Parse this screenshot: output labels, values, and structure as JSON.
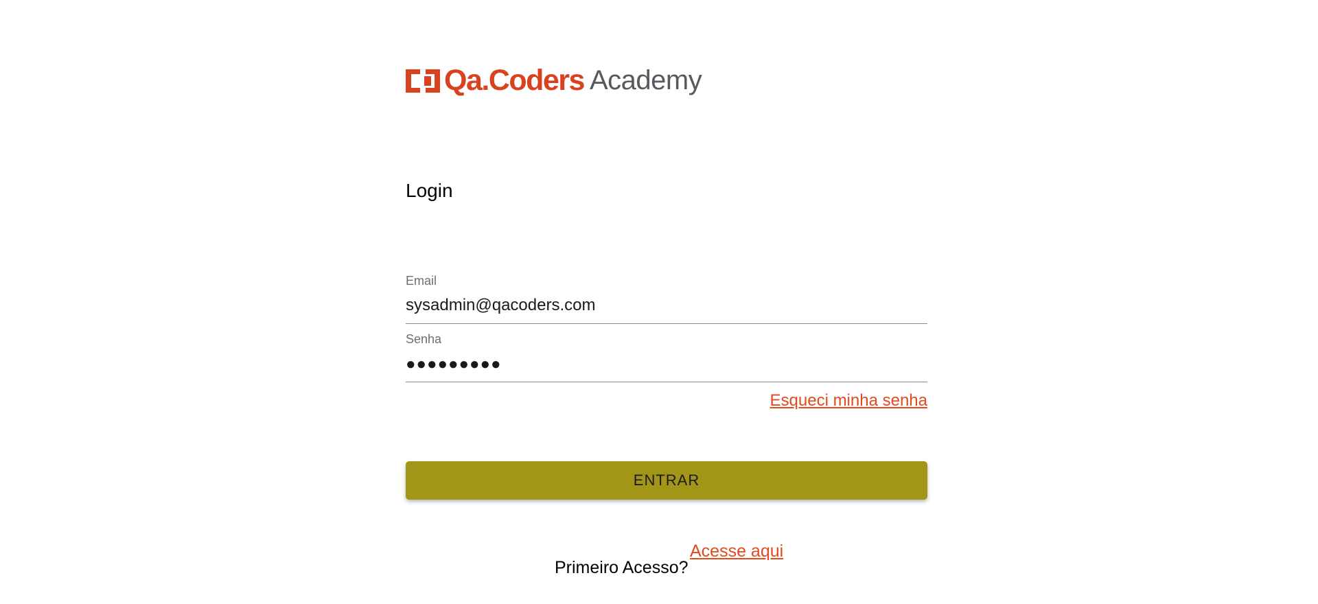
{
  "logo": {
    "brand": "Qa.Coders",
    "suffix": "Academy",
    "icon": "qa-coders-bracket-logo-icon",
    "color": "#d8421e",
    "suffix_color": "#555a5f"
  },
  "login": {
    "title": "Login"
  },
  "email": {
    "label": "Email",
    "value": "sysadmin@qacoders.com"
  },
  "password": {
    "label": "Senha",
    "masked_value": "●●●●●●●●●"
  },
  "forgot_password": {
    "label": "Esqueci minha senha"
  },
  "submit": {
    "label": "ENTRAR",
    "color": "#a39518"
  },
  "first_access": {
    "question": "Primeiro Acesso?",
    "link_label": "Acesse aqui"
  },
  "colors": {
    "link": "#e24a1c",
    "background": "#ffffff"
  }
}
